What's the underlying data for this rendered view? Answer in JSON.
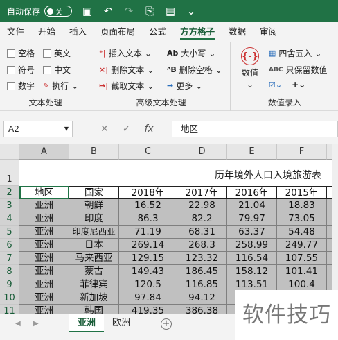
{
  "titlebar": {
    "autosave_label": "自动保存",
    "toggle_state": "关"
  },
  "tabs": [
    "文件",
    "开始",
    "插入",
    "页面布局",
    "公式",
    "方方格子",
    "数据",
    "审阅"
  ],
  "active_tab": "方方格子",
  "ribbon": {
    "text_group": {
      "label": "文本处理",
      "checkboxes": [
        "空格",
        "英文",
        "符号",
        "中文",
        "数字"
      ],
      "exec_button": "执行"
    },
    "adv_group": {
      "label": "高级文本处理",
      "insert_text": "插入文本",
      "delete_text": "删除文本",
      "extract_text": "截取文本",
      "case": "大小写",
      "remove_space": "删除空格",
      "more": "更多"
    },
    "num_group": {
      "label": "数值录入",
      "value_button": "数值",
      "round": "四舍五入",
      "keep_value": "只保留数值"
    }
  },
  "formula_bar": {
    "cell_ref": "A2",
    "content": "地区"
  },
  "sheet": {
    "title": "历年境外人口入境旅游表",
    "columns": [
      "A",
      "B",
      "C",
      "D",
      "E",
      "F"
    ],
    "rows": [
      "1",
      "2",
      "3",
      "4",
      "5",
      "6",
      "7",
      "8",
      "9",
      "10",
      "11"
    ],
    "header": [
      "地区",
      "国家",
      "2018年",
      "2017年",
      "2016年",
      "2015年"
    ],
    "data": [
      [
        "亚洲",
        "朝鲜",
        "16.52",
        "22.98",
        "21.04",
        "18.83"
      ],
      [
        "亚洲",
        "印度",
        "86.3",
        "82.2",
        "79.97",
        "73.05"
      ],
      [
        "亚洲",
        "印度尼西亚",
        "71.19",
        "68.31",
        "63.37",
        "54.48"
      ],
      [
        "亚洲",
        "日本",
        "269.14",
        "268.3",
        "258.99",
        "249.77"
      ],
      [
        "亚洲",
        "马来西亚",
        "129.15",
        "123.32",
        "116.54",
        "107.55"
      ],
      [
        "亚洲",
        "蒙古",
        "149.43",
        "186.45",
        "158.12",
        "101.41"
      ],
      [
        "亚洲",
        "菲律宾",
        "120.5",
        "116.85",
        "113.51",
        "100.4"
      ],
      [
        "亚洲",
        "新加坡",
        "97.84",
        "94.12",
        "",
        ""
      ],
      [
        "亚洲",
        "韩国",
        "419.35",
        "386.38",
        "",
        ""
      ]
    ]
  },
  "sheet_tabs": [
    "亚洲",
    "欧洲"
  ],
  "active_sheet": "亚洲",
  "watermark": "软件技巧"
}
